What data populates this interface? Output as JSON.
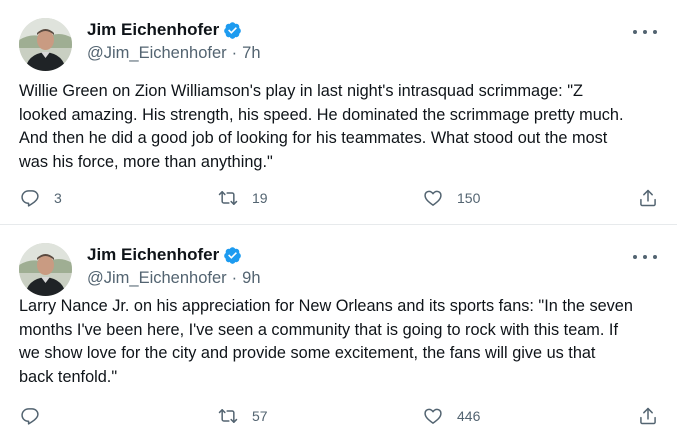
{
  "tweets": [
    {
      "author": {
        "name": "Jim Eichenhofer",
        "handle": "@Jim_Eichenhofer",
        "time": "7h",
        "verified": true
      },
      "text": "Willie Green on Zion Williamson's play in last night's intrasquad scrimmage: \"Z\nlooked amazing. His strength, his speed. He dominated the scrimmage pretty much.\nAnd then he did a good job of looking for his teammates. What stood out the most\nwas his force, more than anything.\"",
      "stats": {
        "replies": "3",
        "retweets": "19",
        "likes": "150"
      }
    },
    {
      "author": {
        "name": "Jim Eichenhofer",
        "handle": "@Jim_Eichenhofer",
        "time": "9h",
        "verified": true
      },
      "text": "Larry Nance Jr. on his appreciation for New Orleans and its sports fans: \"In the seven\nmonths I've been here, I've seen a community that is going to rock with this team. If\nwe show love for the city and provide some excitement, the fans will give us that\nback tenfold.\"",
      "stats": {
        "replies": "",
        "retweets": "57",
        "likes": "446"
      }
    }
  ],
  "colors": {
    "text": "#0f1419",
    "secondary": "#536471",
    "verified": "#1d9bf0"
  },
  "icons": [
    "reply-icon",
    "retweet-icon",
    "like-icon",
    "share-icon",
    "verified-icon",
    "more-icon"
  ]
}
